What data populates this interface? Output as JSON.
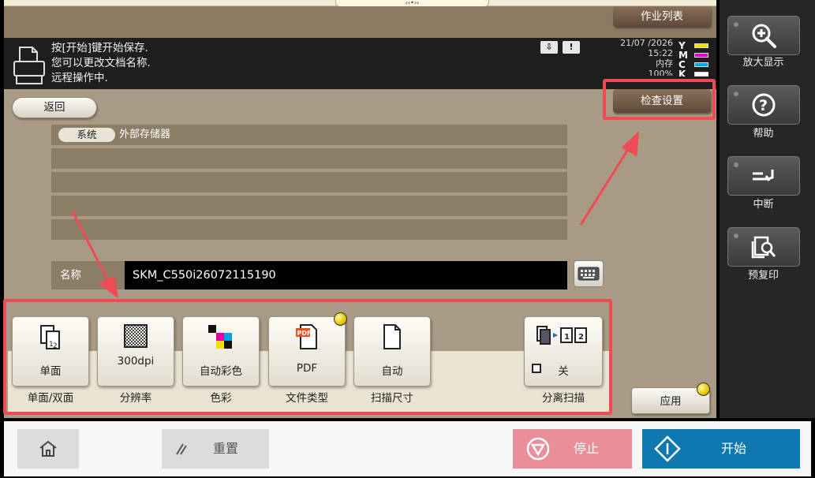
{
  "window": {
    "title_handle": "‹‹•››"
  },
  "header": {
    "jobs_label": "作业列表"
  },
  "status": {
    "lines": [
      "按[开始]键开始保存.",
      "您可以更改文档名称.",
      "远程操作中."
    ],
    "badge_1": "⇩",
    "badge_2": "!",
    "date": "21/07 /2026",
    "time": "15:22",
    "memory_label": "内存",
    "memory_value": "100%",
    "toner": [
      {
        "letter": "Y",
        "color": "#f0e000"
      },
      {
        "letter": "M",
        "color": "#e000c8"
      },
      {
        "letter": "C",
        "color": "#00a8e8"
      },
      {
        "letter": "K",
        "color": "#ffffff"
      }
    ]
  },
  "nav": {
    "back_label": "返回",
    "check_settings_label": "检查设置"
  },
  "path": {
    "system_chip": "系统",
    "location": "外部存储器"
  },
  "document": {
    "name_label": "名称",
    "name_value": "SKM_C550i26072115190"
  },
  "functions": [
    {
      "value": "单面",
      "caption": "单面/双面",
      "icon": "duplex-page-icon"
    },
    {
      "value": "300dpi",
      "caption": "分辨率",
      "icon": "resolution-grid-icon"
    },
    {
      "value": "自动彩色",
      "caption": "色彩",
      "icon": "color-squares-icon"
    },
    {
      "value": "PDF",
      "caption": "文件类型",
      "icon": "pdf-file-icon"
    },
    {
      "value": "自动",
      "caption": "扫描尺寸",
      "icon": "page-size-icon"
    },
    {
      "value": "关",
      "caption": "分离扫描",
      "icon": "separate-scan-icon"
    }
  ],
  "apply_label": "应用",
  "side": {
    "zoom_label": "放大显示",
    "help_label": "帮助",
    "interrupt_label": "中断",
    "preview_label": "预复印"
  },
  "bottom": {
    "reset_label": "重置",
    "stop_label": "停止",
    "start_label": "开始"
  },
  "colors": {
    "highlight": "#ef4b55",
    "start_blue": "#0d79b0",
    "stop_pink": "#ea8e9a"
  }
}
